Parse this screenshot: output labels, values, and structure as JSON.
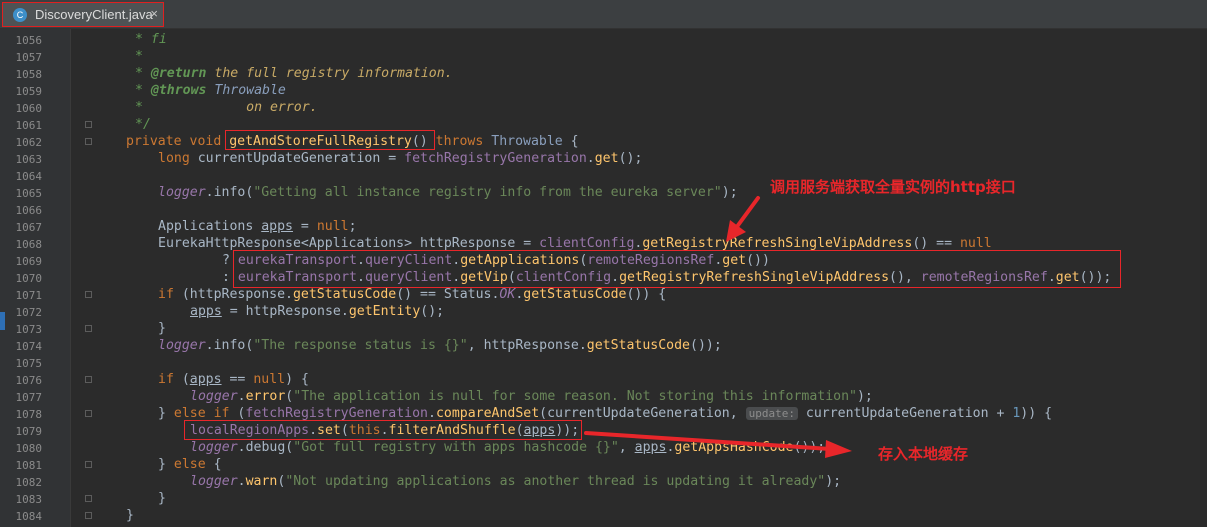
{
  "tab": {
    "title": "DiscoveryClient.java",
    "icon": "class-icon",
    "close": "×"
  },
  "line_numbers": [
    "1056",
    "1057",
    "1058",
    "1059",
    "1060",
    "1061",
    "1062",
    "1063",
    "1064",
    "1065",
    "1066",
    "1067",
    "1068",
    "1069",
    "1070",
    "1071",
    "1072",
    "1073",
    "1074",
    "1075",
    "1076",
    "1077",
    "1078",
    "1079",
    "1080",
    "1081",
    "1082",
    "1083",
    "1084"
  ],
  "code": {
    "l1056": {
      "star": "* ",
      "text": "fi"
    },
    "l1057": {
      "star": "*"
    },
    "l1058": {
      "star": "* ",
      "tag": "@return",
      "text": " the full registry information."
    },
    "l1059": {
      "star": "* ",
      "tag": "@throws",
      "ref": " Throwable"
    },
    "l1060": {
      "star": "*",
      "text": "             on error."
    },
    "l1061": {
      "star": "*/"
    },
    "l1062": {
      "mods": "private void ",
      "name": "getAndStoreFullRegistry",
      "paren": "()",
      "throws_kw": " throws ",
      "throws_type": "Throwable",
      "brace": " {"
    },
    "l1063": {
      "type": "long ",
      "var": "currentUpdateGeneration",
      "eq": " = ",
      "obj": "fetchRegistryGeneration",
      "dot": ".",
      "call": "get",
      "end": "();"
    },
    "l1065": {
      "obj": "logger",
      "dot": ".",
      "call": "info",
      "open": "(",
      "str": "\"Getting all instance registry info from the eureka server\"",
      "end": ");"
    },
    "l1067": {
      "type": "Applications ",
      "var": "apps",
      "eq": " = ",
      "null": "null",
      "end": ";"
    },
    "l1068": {
      "type": "EurekaHttpResponse<Applications> ",
      "var": "httpResponse",
      "eq": " = ",
      "obj": "clientConfig",
      "dot": ".",
      "call": "getRegistryRefreshSingleVipAddress",
      "end": "() == ",
      "null": "null"
    },
    "l1069": {
      "op": "? ",
      "a": "eurekaTransport",
      "b": ".",
      "c": "queryClient",
      "d": ".",
      "e": "getApplications",
      "f": "(",
      "g": "remoteRegionsRef",
      "h": ".",
      "i": "get",
      "j": "())"
    },
    "l1070": {
      "op": ": ",
      "a": "eurekaTransport",
      "b": ".",
      "c": "queryClient",
      "d": ".",
      "e": "getVip",
      "f": "(",
      "g": "clientConfig",
      "h": ".",
      "i": "getRegistryRefreshSingleVipAddress",
      "j": "(), ",
      "k": "remoteRegionsRef",
      "l": ".",
      "m": "get",
      "n": "());"
    },
    "l1071": {
      "kw": "if ",
      "a": "(httpResponse.",
      "b": "getStatusCode",
      "c": "() == Status.",
      "d": "OK",
      "e": ".",
      "f": "getStatusCode",
      "g": "()) {"
    },
    "l1072": {
      "var": "apps",
      "eq": " = httpResponse.",
      "call": "getEntity",
      "end": "();"
    },
    "l1073": {
      "brace": "}"
    },
    "l1074": {
      "obj": "logger",
      "dot": ".",
      "call": "info",
      "open": "(",
      "str": "\"The response status is {}\"",
      "mid": ", httpResponse.",
      "call2": "getStatusCode",
      "end": "());"
    },
    "l1076": {
      "kw": "if ",
      "a": "(",
      "var": "apps",
      "b": " == ",
      "null": "null",
      "c": ") {"
    },
    "l1077": {
      "obj": "logger",
      "dot": ".",
      "call": "error",
      "open": "(",
      "str": "\"The application is null for some reason. Not storing this information\"",
      "end": ");"
    },
    "l1078": {
      "a": "} ",
      "kw": "else if ",
      "b": "(",
      "obj": "fetchRegistryGeneration",
      "dot": ".",
      "call": "compareAndSet",
      "c": "(currentUpdateGeneration, ",
      "hint": "update:",
      "d": " currentUpdateGeneration + ",
      "num": "1",
      "e": ")) {"
    },
    "l1079": {
      "obj": "localRegionApps",
      "dot": ".",
      "call": "set",
      "open": "(",
      "kw": "this",
      "dot2": ".",
      "call2": "filterAndShuffle",
      "open2": "(",
      "var": "apps",
      "end": "));"
    },
    "l1080": {
      "obj": "logger",
      "dot": ".",
      "call": "debug",
      "open": "(",
      "str": "\"Got full registry with apps hashcode {}\"",
      "mid": ", ",
      "var": "apps",
      "dot2": ".",
      "call2": "getAppsHashCode",
      "end": "());"
    },
    "l1081": {
      "a": "} ",
      "kw": "else",
      "b": " {"
    },
    "l1082": {
      "obj": "logger",
      "dot": ".",
      "call": "warn",
      "open": "(",
      "str": "\"Not updating applications as another thread is updating it already\"",
      "end": ");"
    },
    "l1083": {
      "brace": "}"
    },
    "l1084": {
      "brace": "}"
    }
  },
  "annotations": {
    "top_note": "调用服务端获取全量实例的http接口",
    "bottom_note": "存入本地缓存",
    "color": "#e8262a"
  },
  "theme": {
    "background": "#2b2b2b",
    "gutter": "#313335",
    "keyword": "#cc7832",
    "method": "#ffc66d",
    "field": "#9876aa",
    "string": "#6a8759",
    "comment": "#629755"
  }
}
